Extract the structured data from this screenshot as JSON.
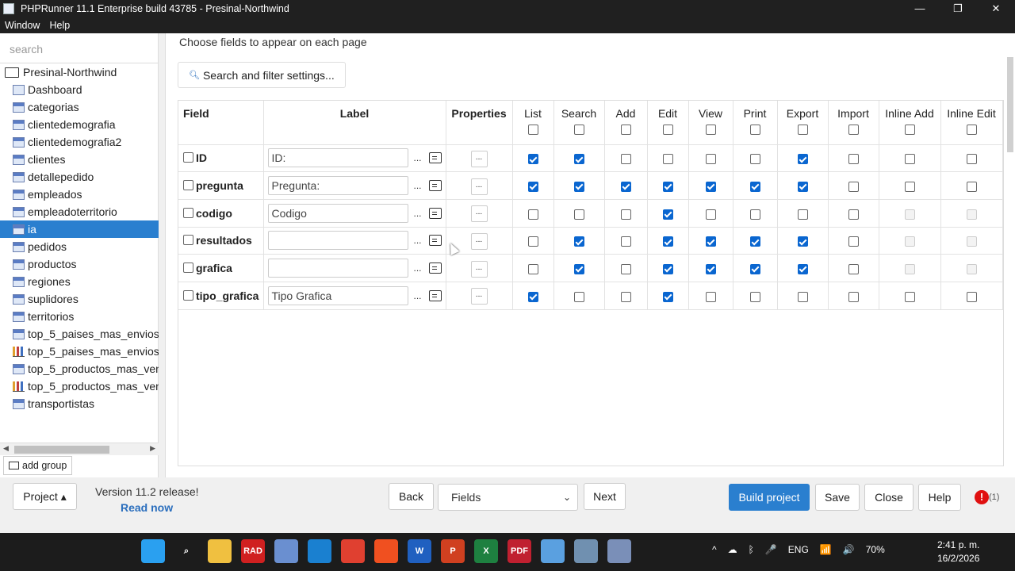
{
  "window": {
    "title": "PHPRunner 11.1 Enterprise build 43785 - Presinal-Northwind",
    "min": "—",
    "max": "❐",
    "close": "✕"
  },
  "menu": {
    "items": [
      "Window",
      "Help"
    ]
  },
  "sidebar": {
    "search_placeholder": "search",
    "root": "Presinal-Northwind",
    "items": [
      {
        "label": "Dashboard",
        "icon": "dashboard-icon"
      },
      {
        "label": "categorias",
        "icon": "table-icon"
      },
      {
        "label": "clientedemografia",
        "icon": "table-icon"
      },
      {
        "label": "clientedemografia2",
        "icon": "table-icon"
      },
      {
        "label": "clientes",
        "icon": "table-icon"
      },
      {
        "label": "detallepedido",
        "icon": "table-icon"
      },
      {
        "label": "empleados",
        "icon": "table-icon"
      },
      {
        "label": "empleadoterritorio",
        "icon": "table-icon"
      },
      {
        "label": "ia",
        "icon": "table-icon",
        "selected": true
      },
      {
        "label": "pedidos",
        "icon": "table-icon"
      },
      {
        "label": "productos",
        "icon": "table-icon"
      },
      {
        "label": "regiones",
        "icon": "table-icon"
      },
      {
        "label": "suplidores",
        "icon": "table-icon"
      },
      {
        "label": "territorios",
        "icon": "table-icon"
      },
      {
        "label": "top_5_paises_mas_envios",
        "icon": "table-icon"
      },
      {
        "label": "top_5_paises_mas_envios",
        "icon": "chart-icon"
      },
      {
        "label": "top_5_productos_mas_ven",
        "icon": "table-icon"
      },
      {
        "label": "top_5_productos_mas_ven",
        "icon": "chart-icon"
      },
      {
        "label": "transportistas",
        "icon": "table-icon"
      }
    ],
    "add_group": "add group"
  },
  "main": {
    "heading": "Choose fields to appear on each page",
    "filter_button": "Search and filter settings...",
    "columns": [
      "Field",
      "Label",
      "Properties",
      "List",
      "Search",
      "Add",
      "Edit",
      "View",
      "Print",
      "Export",
      "Import",
      "Inline Add",
      "Inline Edit"
    ],
    "rows": [
      {
        "field": "ID",
        "label": "ID:",
        "checks": [
          1,
          1,
          0,
          0,
          0,
          0,
          1,
          0,
          0,
          0
        ]
      },
      {
        "field": "pregunta",
        "label": "Pregunta:",
        "checks": [
          1,
          1,
          1,
          1,
          1,
          1,
          1,
          0,
          0,
          0
        ]
      },
      {
        "field": "codigo",
        "label": "Codigo",
        "checks": [
          0,
          0,
          0,
          1,
          0,
          0,
          0,
          0,
          -1,
          -1
        ]
      },
      {
        "field": "resultados",
        "label": "",
        "checks": [
          0,
          1,
          0,
          1,
          1,
          1,
          1,
          0,
          -1,
          -1
        ]
      },
      {
        "field": "grafica",
        "label": "",
        "checks": [
          0,
          1,
          0,
          1,
          1,
          1,
          1,
          0,
          -1,
          -1
        ]
      },
      {
        "field": "tipo_grafica",
        "label": "Tipo Grafica",
        "checks": [
          1,
          0,
          0,
          1,
          0,
          0,
          0,
          0,
          0,
          0
        ]
      }
    ],
    "dots": "...",
    "filter_icon": "search-icon"
  },
  "footer": {
    "project": "Project ▴",
    "version": "Version 11.2 release!",
    "read_now": "Read now",
    "back": "Back",
    "page_select": "Fields",
    "next": "Next",
    "build": "Build project",
    "save": "Save",
    "close": "Close",
    "help": "Help",
    "alert_mark": "!",
    "alert_count": "(1)"
  },
  "taskbar": {
    "icons": [
      {
        "name": "windows-start-icon",
        "text": "",
        "color": "#2aa0f0"
      },
      {
        "name": "search-icon",
        "text": "⌕",
        "color": "transparent"
      },
      {
        "name": "file-explorer-icon",
        "text": "",
        "color": "#f0c040"
      },
      {
        "name": "rad-icon",
        "text": "RAD",
        "color": "#d02020"
      },
      {
        "name": "calendar-app-icon",
        "text": "",
        "color": "#6a8fd0"
      },
      {
        "name": "vscode-icon",
        "text": "",
        "color": "#1a80d0"
      },
      {
        "name": "chrome-icon",
        "text": "",
        "color": "#e04030"
      },
      {
        "name": "brave-icon",
        "text": "",
        "color": "#f05020"
      },
      {
        "name": "word-icon",
        "text": "W",
        "color": "#2060c0"
      },
      {
        "name": "powerpoint-icon",
        "text": "P",
        "color": "#d04020"
      },
      {
        "name": "excel-icon",
        "text": "X",
        "color": "#1e8040"
      },
      {
        "name": "pdf-icon",
        "text": "PDF",
        "color": "#c02030"
      },
      {
        "name": "notepad-icon",
        "text": "",
        "color": "#5aa0e0"
      },
      {
        "name": "calculator-icon",
        "text": "",
        "color": "#7090b0"
      },
      {
        "name": "phprunner-icon",
        "text": "",
        "color": "#7a8fb8"
      }
    ],
    "tray": [
      "^",
      "☁",
      "ᛒ",
      "🎤",
      "ENG",
      "📶",
      "🔊",
      "70%"
    ],
    "time": "2:41 p. m.",
    "date": "16/2/2026"
  }
}
